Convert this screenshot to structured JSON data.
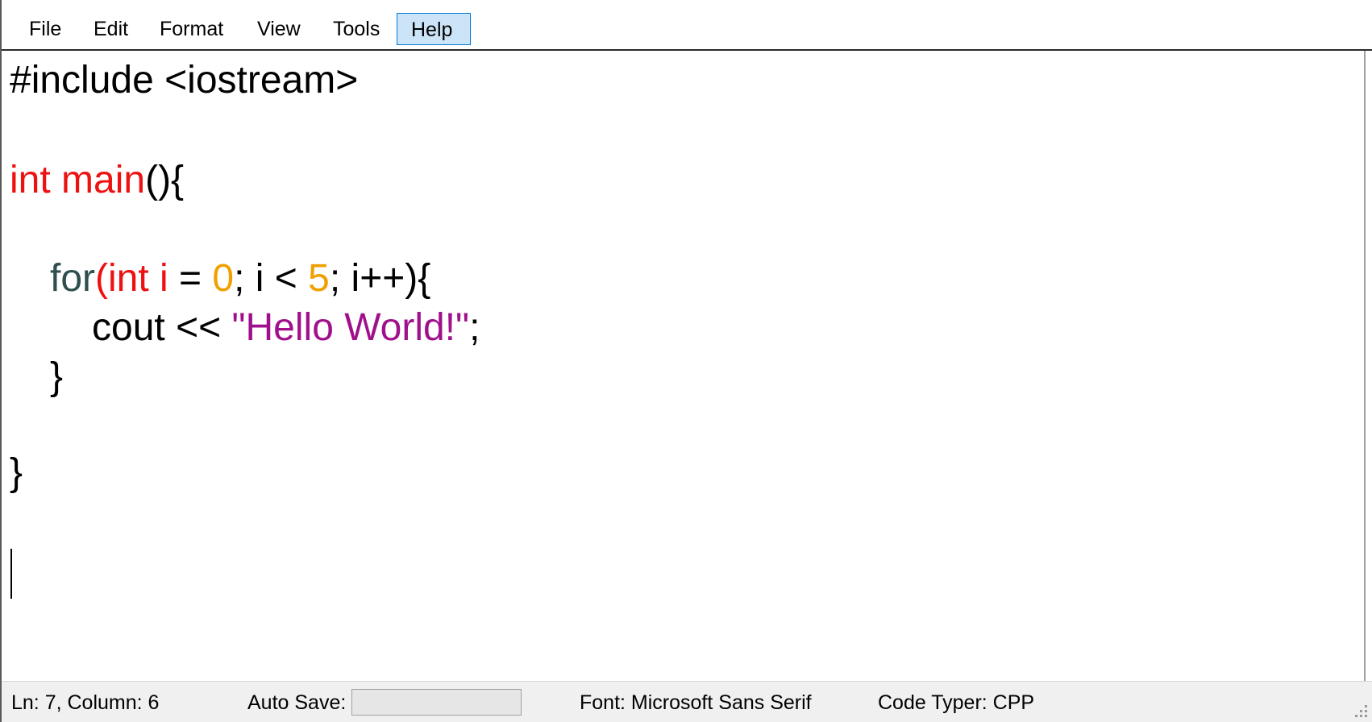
{
  "menu": {
    "items": [
      {
        "label": "File"
      },
      {
        "label": "Edit"
      },
      {
        "label": "Format"
      },
      {
        "label": "View"
      },
      {
        "label": "Tools"
      },
      {
        "label": "Help",
        "active": true
      }
    ]
  },
  "editor": {
    "line1": {
      "text": "#include <iostream>"
    },
    "line3": {
      "kw": "int main",
      "rest": "(){"
    },
    "line5": {
      "kw1": "for",
      "paren": "(",
      "kw2": "int i",
      "eq": " = ",
      "n1": "0",
      "mid": "; i < ",
      "n2": "5",
      "tail": "; i++){"
    },
    "line6": {
      "text": "cout << ",
      "str": "\"Hello World!\"",
      "semi": ";"
    },
    "line7": {
      "text": "}"
    },
    "line9": {
      "text": "}"
    }
  },
  "syntax_colors": {
    "keyword": "#ee1111",
    "loop_keyword": "#2f4f4f",
    "number": "#f0a000",
    "string": "#a0108c"
  },
  "status": {
    "position": "Ln: 7, Column: 6",
    "autosave_label": "Auto Save:",
    "font": "Font: Microsoft Sans Serif",
    "code_type": "Code Typer: CPP"
  }
}
